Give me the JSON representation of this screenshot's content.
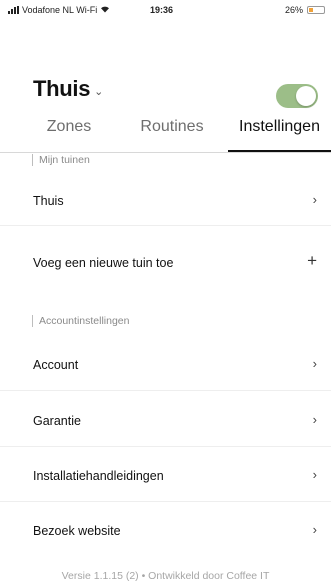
{
  "status_bar": {
    "carrier": "Vodafone NL Wi-Fi",
    "time": "19:36",
    "battery": "26%",
    "battery_level": 0.26
  },
  "header": {
    "title": "Thuis",
    "title_chevron": "chevron-down-icon",
    "toggle_on": true,
    "toggle_color": "#9cbe88"
  },
  "tabs": [
    {
      "label": "Zones",
      "active": false
    },
    {
      "label": "Routines",
      "active": false
    },
    {
      "label": "Instellingen",
      "active": true
    }
  ],
  "sections": {
    "gardens_title": "Mijn tuinen",
    "account_title": "Accountinstellingen"
  },
  "gardens": [
    {
      "label": "Thuis",
      "icon": "chevron-right-icon"
    },
    {
      "label": "Voeg een nieuwe tuin toe",
      "icon": "plus-icon"
    }
  ],
  "account_items": [
    {
      "label": "Account",
      "icon": "chevron-right-icon"
    },
    {
      "label": "Garantie",
      "icon": "chevron-right-icon"
    },
    {
      "label": "Installatiehandleidingen",
      "icon": "chevron-right-icon"
    },
    {
      "label": "Bezoek website",
      "icon": "chevron-right-icon"
    }
  ],
  "footer": {
    "text": "Versie 1.1.15 (2) • Ontwikkeld door Coffee IT"
  }
}
